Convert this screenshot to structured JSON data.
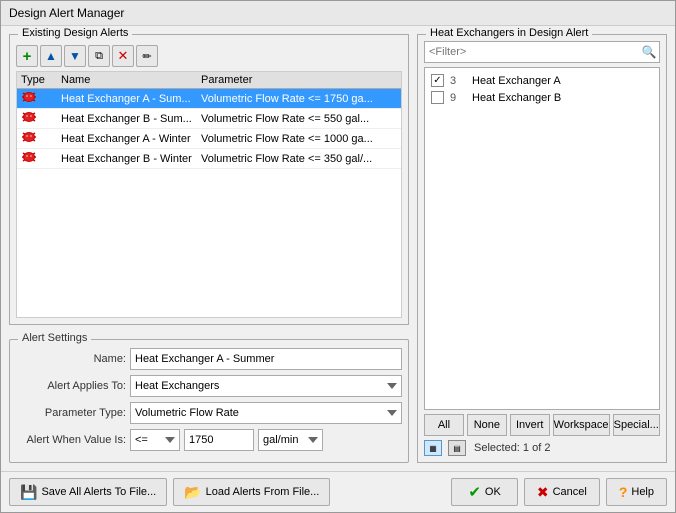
{
  "window": {
    "title": "Design Alert Manager"
  },
  "existing_alerts": {
    "section_title": "Existing Design Alerts",
    "columns": [
      "Type",
      "Name",
      "Parameter"
    ],
    "rows": [
      {
        "type_icon": "alert",
        "name": "Heat Exchanger A - Sum...",
        "parameter": "Volumetric Flow Rate <= 1750 ga...",
        "selected": true
      },
      {
        "type_icon": "alert",
        "name": "Heat Exchanger B - Sum...",
        "parameter": "Volumetric Flow Rate <= 550 gal...",
        "selected": false
      },
      {
        "type_icon": "alert",
        "name": "Heat Exchanger A - Winter",
        "parameter": "Volumetric Flow Rate <= 1000 ga...",
        "selected": false
      },
      {
        "type_icon": "alert",
        "name": "Heat Exchanger B - Winter",
        "parameter": "Volumetric Flow Rate <= 350 gal/...",
        "selected": false
      }
    ],
    "toolbar": {
      "add_label": "+",
      "up_label": "↑",
      "down_label": "↓",
      "copy_label": "⧉",
      "delete_label": "✕",
      "clear_label": "✎"
    }
  },
  "heat_exchangers": {
    "section_title": "Heat Exchangers in Design Alert",
    "filter_placeholder": "<Filter>",
    "items": [
      {
        "num": "3",
        "name": "Heat Exchanger A",
        "checked": true
      },
      {
        "num": "9",
        "name": "Heat Exchanger B",
        "checked": false
      }
    ],
    "buttons": {
      "all": "All",
      "none": "None",
      "invert": "Invert",
      "workspace": "Workspace",
      "special": "Special..."
    },
    "selected_text": "Selected: 1 of 2"
  },
  "alert_settings": {
    "section_title": "Alert Settings",
    "name_label": "Name:",
    "name_value": "Heat Exchanger A - Summer",
    "applies_to_label": "Alert Applies To:",
    "applies_to_value": "Heat Exchangers",
    "parameter_type_label": "Parameter Type:",
    "parameter_type_value": "Volumetric Flow Rate",
    "alert_when_label": "Alert When Value Is:",
    "alert_op_value": "<=",
    "alert_value": "1750",
    "alert_unit": "gal/min"
  },
  "bottom_bar": {
    "save_btn": "Save All Alerts To File...",
    "load_btn": "Load Alerts From File...",
    "ok_btn": "OK",
    "cancel_btn": "Cancel",
    "help_btn": "Help"
  }
}
